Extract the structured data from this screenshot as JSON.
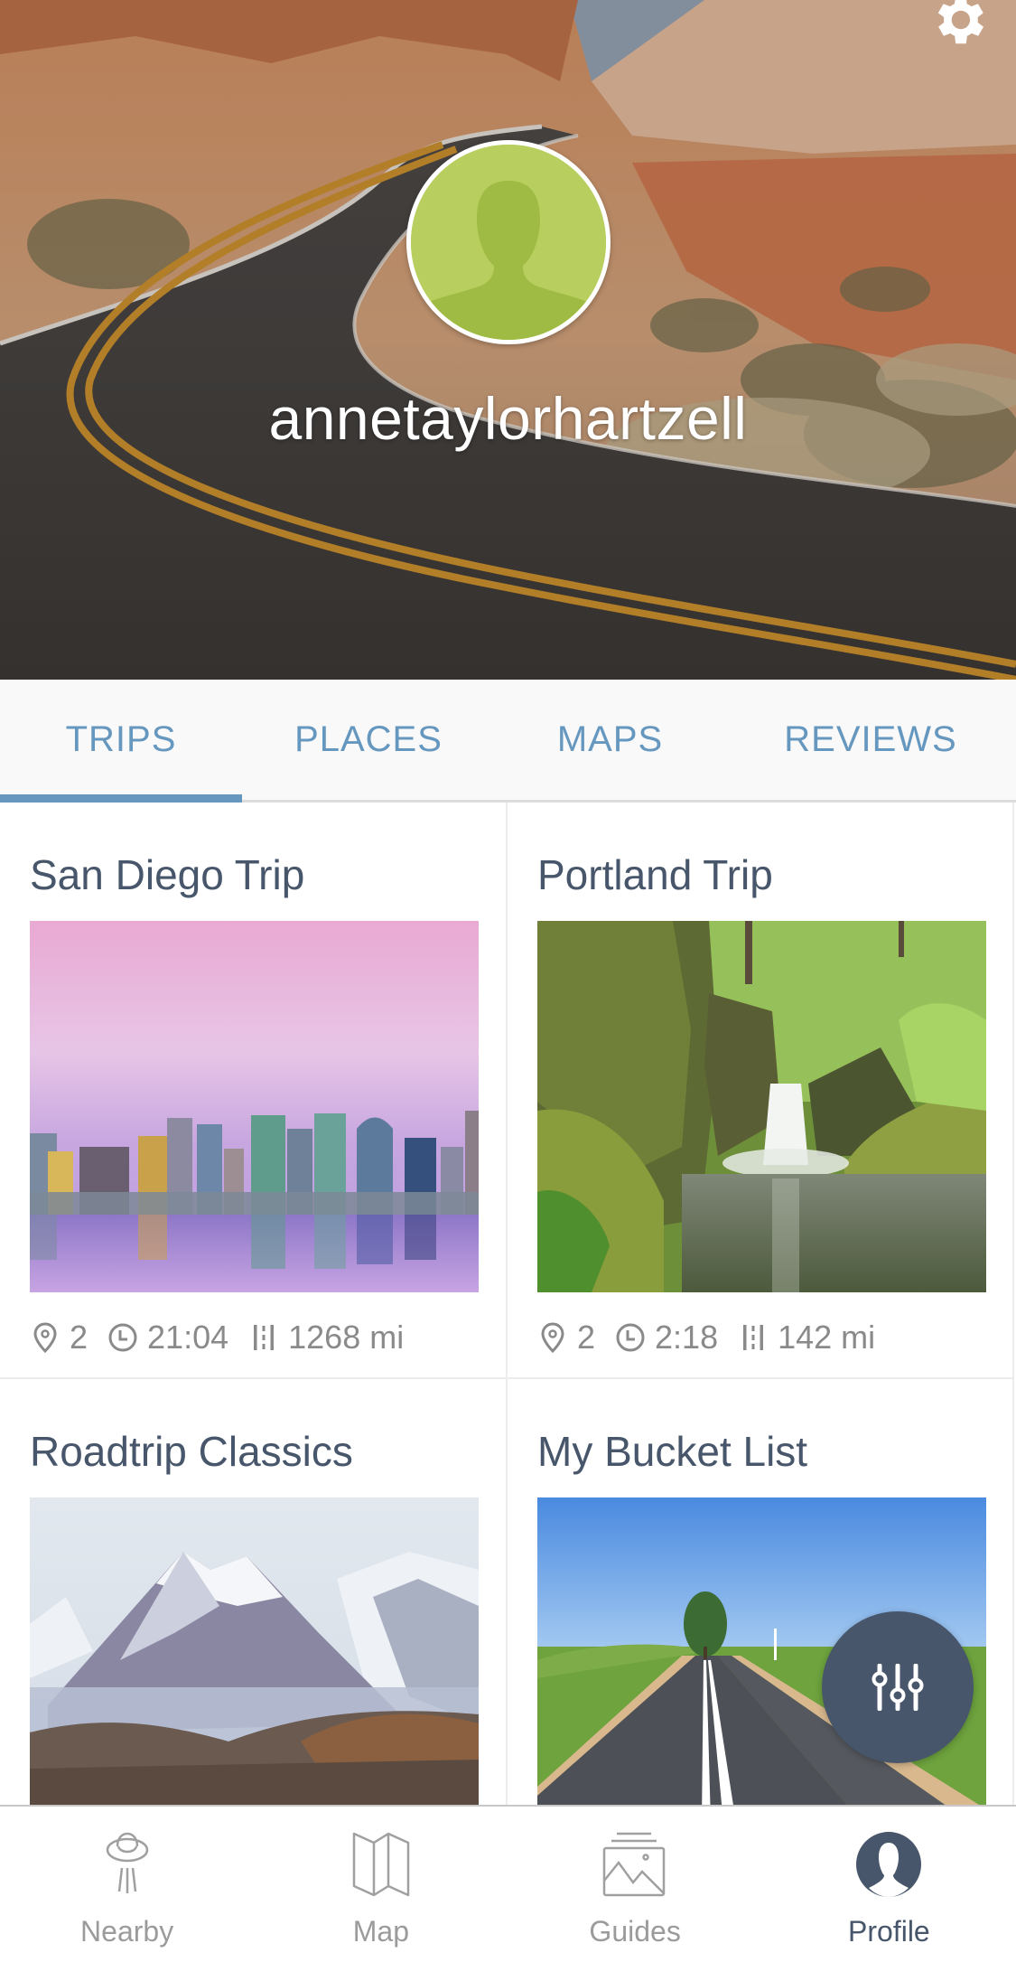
{
  "header": {
    "username": "annetaylorhartzell",
    "settings_icon": "gear-icon",
    "avatar_icon": "default-user-silhouette",
    "background_image": "desert-winding-road"
  },
  "tabs": [
    {
      "label": "TRIPS",
      "active": true
    },
    {
      "label": "PLACES",
      "active": false
    },
    {
      "label": "MAPS",
      "active": false
    },
    {
      "label": "REVIEWS",
      "active": false
    }
  ],
  "trips": [
    {
      "title": "San Diego Trip",
      "image": "san-diego-skyline",
      "stops": "2",
      "duration": "21:04",
      "distance": "1268 mi"
    },
    {
      "title": "Portland Trip",
      "image": "waterfall-forest",
      "stops": "2",
      "duration": "2:18",
      "distance": "142 mi"
    },
    {
      "title": "Roadtrip Classics",
      "image": "snowy-mountains"
    },
    {
      "title": "My Bucket List",
      "image": "country-road-tree"
    }
  ],
  "fab": {
    "icon": "sliders-icon",
    "label": "Filter"
  },
  "bottom_nav": [
    {
      "label": "Nearby",
      "icon": "ufo-icon",
      "active": false
    },
    {
      "label": "Map",
      "icon": "folded-map-icon",
      "active": false
    },
    {
      "label": "Guides",
      "icon": "photo-stack-icon",
      "active": false
    },
    {
      "label": "Profile",
      "icon": "user-circle-icon",
      "active": true
    }
  ],
  "colors": {
    "accent": "#6597bf",
    "dark_text": "#47566a",
    "muted": "#9b9b9b",
    "avatar_green": "#b8cf5f"
  }
}
